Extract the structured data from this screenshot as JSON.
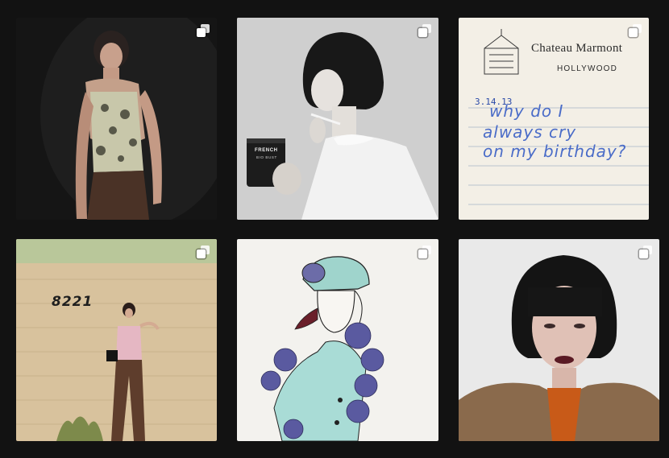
{
  "posts": [
    {
      "id": "p1",
      "subject": "woman-in-floral-camisole",
      "multi": true
    },
    {
      "id": "p2",
      "subject": "woman-with-candle-mug",
      "multi": true,
      "mug_text_1": "FRENCH",
      "mug_text_2": "BIO BUST"
    },
    {
      "id": "p3",
      "subject": "hotel-notecard",
      "multi": true,
      "hotel_name": "Chateau Marmont",
      "hotel_city": "HOLLYWOOD",
      "note_date": "3.14.13",
      "note_line_1": "why do I",
      "note_line_2": "always cry",
      "note_line_3": "on my birthday?"
    },
    {
      "id": "p4",
      "subject": "woman-against-brick-wall",
      "multi": true,
      "address_number": "8221"
    },
    {
      "id": "p5",
      "subject": "fashion-illustration",
      "multi": true
    },
    {
      "id": "p6",
      "subject": "portrait-bob-haircut",
      "multi": true
    }
  ],
  "colors": {
    "background": "#121212",
    "icon": "#ffffff"
  }
}
